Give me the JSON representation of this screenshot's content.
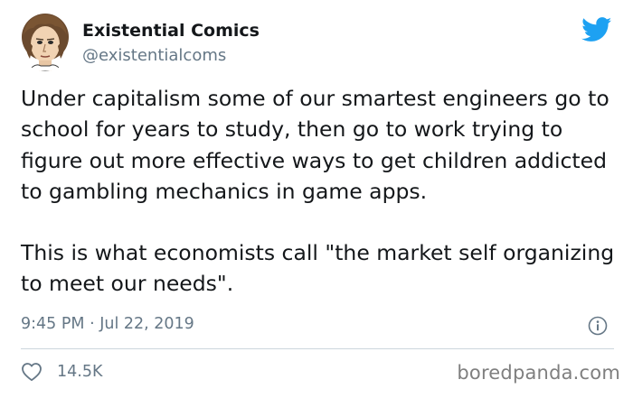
{
  "author": {
    "name": "Existential Comics",
    "handle": "@existentialcoms",
    "avatar_icon": "cartoon-portrait-avatar"
  },
  "platform": {
    "logo_icon": "twitter-bird-icon",
    "brand_color": "#1da1f2"
  },
  "tweet": {
    "paragraph_1": "Under capitalism some of our smartest engineers go to school for years to study, then go to work trying to figure out more effective ways to get children addicted to gambling mechanics in game apps.",
    "paragraph_2": "This is what economists call \"the market self organizing to meet our needs\".",
    "timestamp": "9:45 PM · Jul 22, 2019"
  },
  "actions": {
    "info_icon": "info-icon",
    "like_icon": "heart-icon",
    "like_count": "14.5K"
  },
  "watermark": "boredpanda.com",
  "colors": {
    "text_primary": "#14171a",
    "text_secondary": "#657786",
    "divider": "#ccd6dd"
  }
}
